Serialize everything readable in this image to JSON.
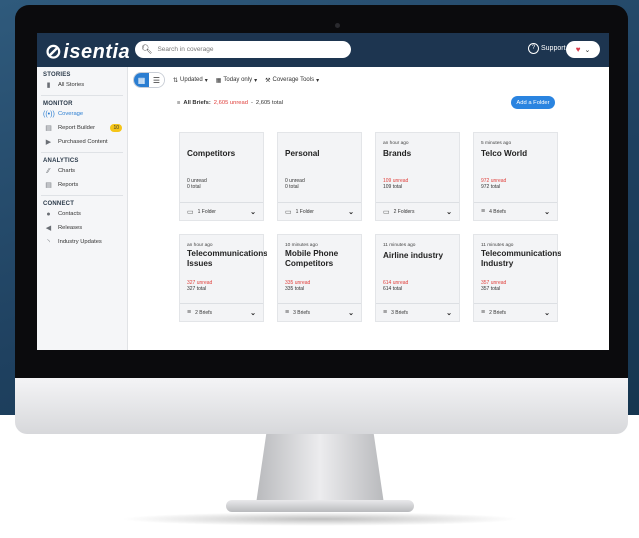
{
  "app": {
    "logo": "isentia",
    "search_placeholder": "Search in coverage",
    "support_label": "Support"
  },
  "sidebar": {
    "stories_heading": "STORIES",
    "all_stories": "All Stories",
    "monitor_heading": "MONITOR",
    "coverage": "Coverage",
    "report_builder": "Report Builder",
    "report_builder_badge": "10",
    "purchased_content": "Purchased Content",
    "analytics_heading": "ANALYTICS",
    "charts": "Charts",
    "reports": "Reports",
    "connect_heading": "CONNECT",
    "contacts": "Contacts",
    "releases": "Releases",
    "industry_updates": "Industry Updates"
  },
  "toolbar": {
    "sort": "Updated",
    "date": "Today only",
    "tools": "Coverage Tools"
  },
  "summary": {
    "label": "All Briefs:",
    "unread": "2,605 unread",
    "sep": "-",
    "total": "2,605 total"
  },
  "add_folder_label": "Add a Folder",
  "colors": {
    "accent": "#2a84e0",
    "unread": "#e0403c",
    "topbar": "#1d3550"
  },
  "cards": [
    {
      "time": "",
      "name": "Competitors",
      "unread": "0 unread",
      "total": "0 total",
      "footer": "1 Folder",
      "icon": "folder-icon"
    },
    {
      "time": "",
      "name": "Personal",
      "unread": "0 unread",
      "total": "0 total",
      "footer": "1 Folder",
      "icon": "folder-icon"
    },
    {
      "time": "an hour ago",
      "name": "Brands",
      "unread": "109 unread",
      "total": "109 total",
      "footer": "2 Folders",
      "icon": "folders-icon"
    },
    {
      "time": "5 minutes ago",
      "name": "Telco World",
      "unread": "972 unread",
      "total": "972 total",
      "footer": "4 Briefs",
      "icon": "list-icon"
    },
    {
      "time": "an hour ago",
      "name": "Telecommunications",
      "name2": "Issues",
      "unread": "327 unread",
      "total": "327 total",
      "footer": "2 Briefs",
      "icon": "list-icon"
    },
    {
      "time": "10 minutes ago",
      "name": "Mobile Phone",
      "name2": "Competitors",
      "unread": "335 unread",
      "total": "335 total",
      "footer": "3 Briefs",
      "icon": "list-icon"
    },
    {
      "time": "11 minutes ago",
      "name": "Airline industry",
      "unread": "614 unread",
      "total": "614 total",
      "footer": "3 Briefs",
      "icon": "list-icon"
    },
    {
      "time": "11 minutes ago",
      "name": "Telecommunications",
      "name2": "Industry",
      "unread": "357 unread",
      "total": "357 total",
      "footer": "2 Briefs",
      "icon": "list-icon"
    }
  ]
}
